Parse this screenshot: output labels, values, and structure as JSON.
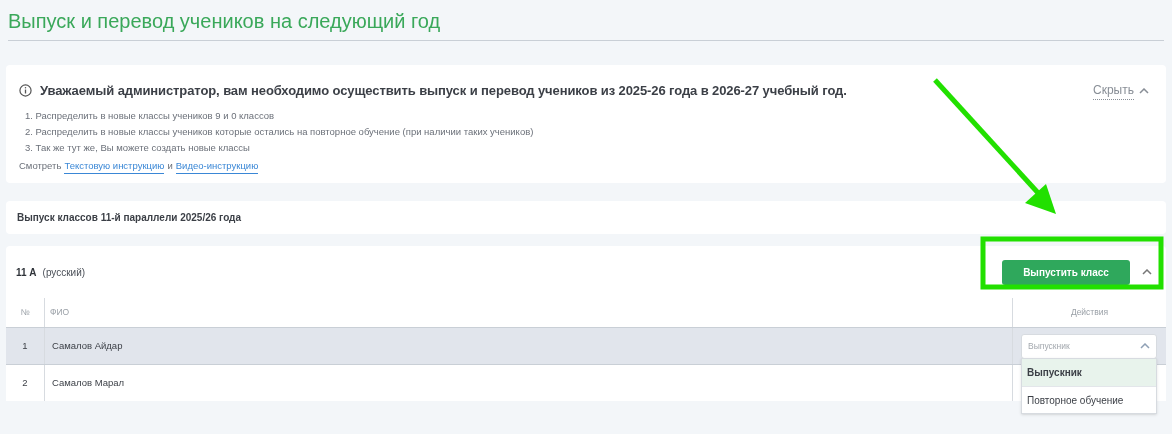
{
  "page_title": "Выпуск и перевод учеников на следующий год",
  "notice": {
    "title": "Уважаемый администратор, вам необходимо осуществить выпуск и перевод учеников из 2025-26 года в 2026-27 учебный год.",
    "hide_link": "Скрыть",
    "expanded": true,
    "steps": [
      "1. Распределить в новые классы учеников 9 и 0 классов",
      "2. Распределить в новые классы учеников которые остались на повторное обучение (при наличии таких учеников)",
      "3. Так же тут же, Вы можете создать новые классы"
    ],
    "see_label": "Смотреть",
    "links": [
      "Текстовую инструкцию",
      "Видео-инструкцию"
    ],
    "and_label": "и"
  },
  "section_title": "Выпуск классов 11-й параллели 2025/26 года",
  "class_card": {
    "name": "11 А",
    "language": "(русский)",
    "release_button": "Выпустить класс",
    "expanded": true,
    "columns": [
      "№",
      "ФИО",
      "Действия"
    ],
    "rows": [
      {
        "number": "1",
        "name": "Самалов Айдар",
        "selected": true,
        "action": {
          "value": "Выпускник",
          "expanded": true,
          "options": [
            {
              "label": "Выпускник",
              "selected": true
            },
            {
              "label": "Повторное обучение",
              "selected": false
            }
          ]
        }
      },
      {
        "number": "2",
        "name": "Самалов Марал",
        "selected": false
      }
    ]
  }
}
